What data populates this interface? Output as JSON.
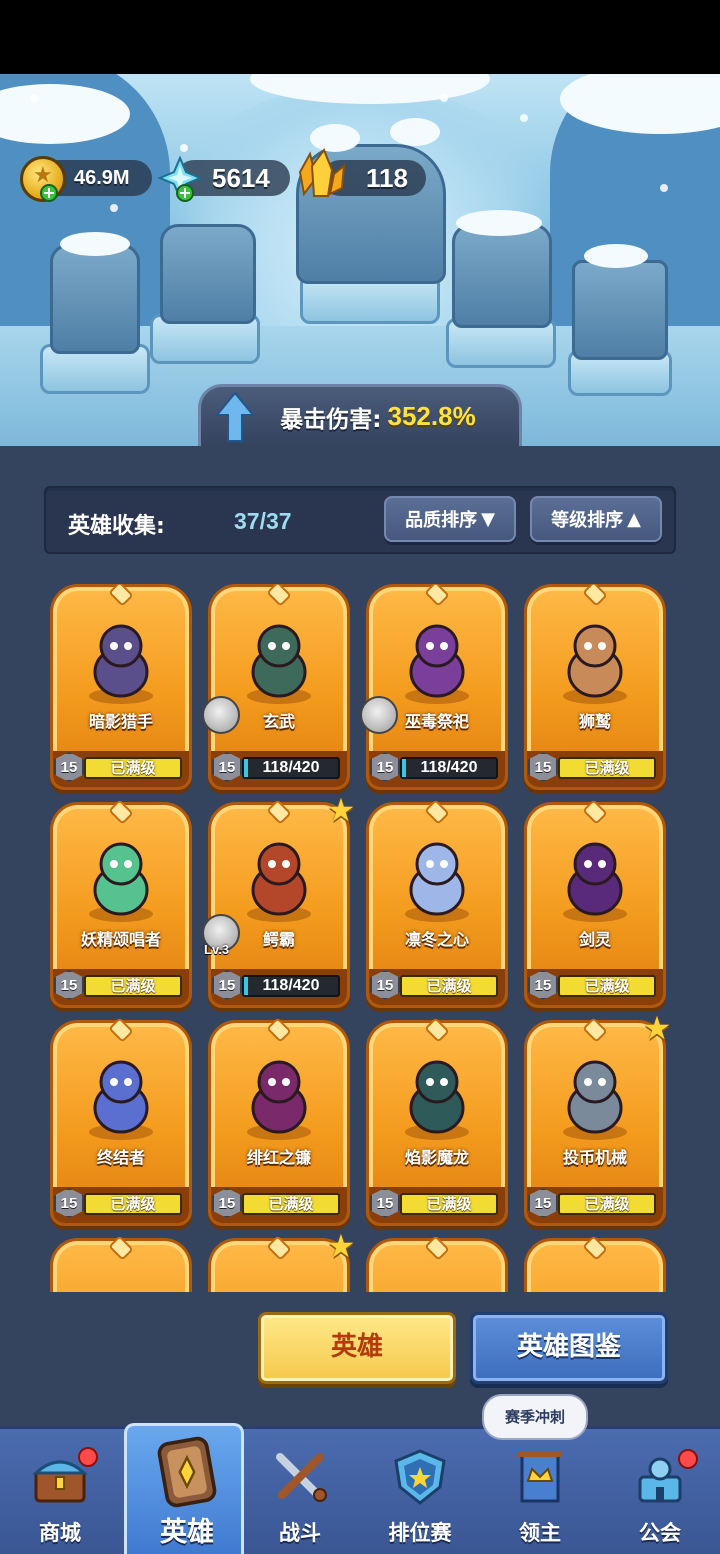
{
  "currency": {
    "gold": "46.9M",
    "gems": "5614",
    "crystals": "118"
  },
  "crit": {
    "label": "暴击伤害:",
    "value": "352.8%"
  },
  "collection": {
    "label": "英雄收集:",
    "count": "37/37",
    "sort_quality": "品质排序",
    "sort_level": "等级排序"
  },
  "heroes": [
    {
      "name": "暗影猎手",
      "level": "15",
      "status": "已满级"
    },
    {
      "name": "玄武",
      "level": "15",
      "progress_text": "118/420",
      "progress": 0.28
    },
    {
      "name": "巫毒祭祀",
      "level": "15",
      "progress_text": "118/420",
      "progress": 0.28
    },
    {
      "name": "狮鹫",
      "level": "15",
      "status": "已满级"
    },
    {
      "name": "妖精颂唱者",
      "level": "15",
      "status": "已满级"
    },
    {
      "name": "鳄霸",
      "level": "15",
      "progress_text": "118/420",
      "progress": 0.28,
      "shard_level": "Lv.3"
    },
    {
      "name": "凛冬之心",
      "level": "15",
      "status": "已满级"
    },
    {
      "name": "剑灵",
      "level": "15",
      "status": "已满级"
    },
    {
      "name": "终结者",
      "level": "15",
      "status": "已满级"
    },
    {
      "name": "绯红之镰",
      "level": "15",
      "status": "已满级"
    },
    {
      "name": "焰影魔龙",
      "level": "15",
      "status": "已满级"
    },
    {
      "name": "投币机械",
      "level": "15",
      "status": "已满级"
    }
  ],
  "buttons": {
    "hero": "英雄",
    "codex": "英雄图鉴"
  },
  "nav": {
    "shop": "商城",
    "hero": "英雄",
    "battle": "战斗",
    "ranked": "排位赛",
    "lord": "领主",
    "guild": "公会",
    "bubble": "赛季冲刺"
  },
  "colors": {
    "card_orange": "#f39b1d",
    "panel": "#34435e",
    "crit_value": "#ffe23a",
    "nav_blue": "#4b6cb0"
  }
}
